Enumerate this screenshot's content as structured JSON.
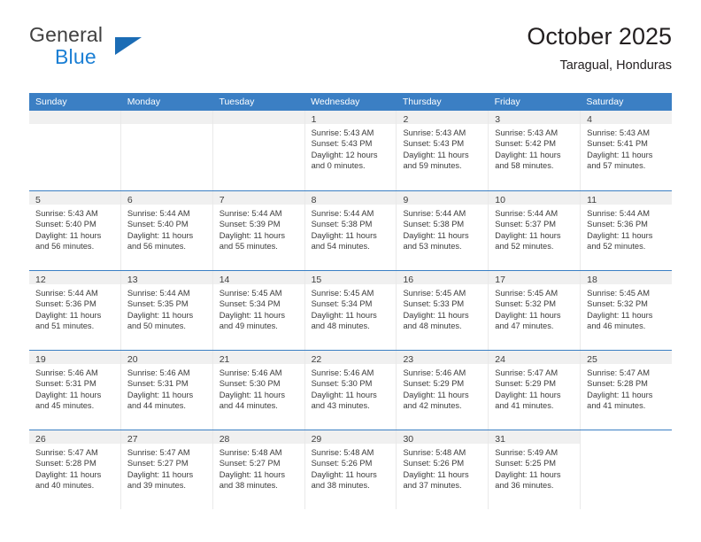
{
  "logo": {
    "word_top": "General",
    "word_bottom": "Blue",
    "triangle_color": "#1b6cb5",
    "blue_color": "#1b7fd4"
  },
  "header": {
    "title": "October 2025",
    "subtitle": "Taragual, Honduras"
  },
  "theme": {
    "header_bar": "#3b7fc4",
    "date_strip": "#f0f0f0",
    "text": "#231f20"
  },
  "weekdays": [
    "Sunday",
    "Monday",
    "Tuesday",
    "Wednesday",
    "Thursday",
    "Friday",
    "Saturday"
  ],
  "labels": {
    "sunrise_prefix": "Sunrise:",
    "sunset_prefix": "Sunset:",
    "daylight_prefix": "Daylight:"
  },
  "weeks": [
    [
      {
        "empty": true
      },
      {
        "empty": true
      },
      {
        "empty": true
      },
      {
        "day": "1",
        "sunrise": "Sunrise: 5:43 AM",
        "sunset": "Sunset: 5:43 PM",
        "daylight_1": "Daylight: 12 hours",
        "daylight_2": "and 0 minutes."
      },
      {
        "day": "2",
        "sunrise": "Sunrise: 5:43 AM",
        "sunset": "Sunset: 5:43 PM",
        "daylight_1": "Daylight: 11 hours",
        "daylight_2": "and 59 minutes."
      },
      {
        "day": "3",
        "sunrise": "Sunrise: 5:43 AM",
        "sunset": "Sunset: 5:42 PM",
        "daylight_1": "Daylight: 11 hours",
        "daylight_2": "and 58 minutes."
      },
      {
        "day": "4",
        "sunrise": "Sunrise: 5:43 AM",
        "sunset": "Sunset: 5:41 PM",
        "daylight_1": "Daylight: 11 hours",
        "daylight_2": "and 57 minutes."
      }
    ],
    [
      {
        "day": "5",
        "sunrise": "Sunrise: 5:43 AM",
        "sunset": "Sunset: 5:40 PM",
        "daylight_1": "Daylight: 11 hours",
        "daylight_2": "and 56 minutes."
      },
      {
        "day": "6",
        "sunrise": "Sunrise: 5:44 AM",
        "sunset": "Sunset: 5:40 PM",
        "daylight_1": "Daylight: 11 hours",
        "daylight_2": "and 56 minutes."
      },
      {
        "day": "7",
        "sunrise": "Sunrise: 5:44 AM",
        "sunset": "Sunset: 5:39 PM",
        "daylight_1": "Daylight: 11 hours",
        "daylight_2": "and 55 minutes."
      },
      {
        "day": "8",
        "sunrise": "Sunrise: 5:44 AM",
        "sunset": "Sunset: 5:38 PM",
        "daylight_1": "Daylight: 11 hours",
        "daylight_2": "and 54 minutes."
      },
      {
        "day": "9",
        "sunrise": "Sunrise: 5:44 AM",
        "sunset": "Sunset: 5:38 PM",
        "daylight_1": "Daylight: 11 hours",
        "daylight_2": "and 53 minutes."
      },
      {
        "day": "10",
        "sunrise": "Sunrise: 5:44 AM",
        "sunset": "Sunset: 5:37 PM",
        "daylight_1": "Daylight: 11 hours",
        "daylight_2": "and 52 minutes."
      },
      {
        "day": "11",
        "sunrise": "Sunrise: 5:44 AM",
        "sunset": "Sunset: 5:36 PM",
        "daylight_1": "Daylight: 11 hours",
        "daylight_2": "and 52 minutes."
      }
    ],
    [
      {
        "day": "12",
        "sunrise": "Sunrise: 5:44 AM",
        "sunset": "Sunset: 5:36 PM",
        "daylight_1": "Daylight: 11 hours",
        "daylight_2": "and 51 minutes."
      },
      {
        "day": "13",
        "sunrise": "Sunrise: 5:44 AM",
        "sunset": "Sunset: 5:35 PM",
        "daylight_1": "Daylight: 11 hours",
        "daylight_2": "and 50 minutes."
      },
      {
        "day": "14",
        "sunrise": "Sunrise: 5:45 AM",
        "sunset": "Sunset: 5:34 PM",
        "daylight_1": "Daylight: 11 hours",
        "daylight_2": "and 49 minutes."
      },
      {
        "day": "15",
        "sunrise": "Sunrise: 5:45 AM",
        "sunset": "Sunset: 5:34 PM",
        "daylight_1": "Daylight: 11 hours",
        "daylight_2": "and 48 minutes."
      },
      {
        "day": "16",
        "sunrise": "Sunrise: 5:45 AM",
        "sunset": "Sunset: 5:33 PM",
        "daylight_1": "Daylight: 11 hours",
        "daylight_2": "and 48 minutes."
      },
      {
        "day": "17",
        "sunrise": "Sunrise: 5:45 AM",
        "sunset": "Sunset: 5:32 PM",
        "daylight_1": "Daylight: 11 hours",
        "daylight_2": "and 47 minutes."
      },
      {
        "day": "18",
        "sunrise": "Sunrise: 5:45 AM",
        "sunset": "Sunset: 5:32 PM",
        "daylight_1": "Daylight: 11 hours",
        "daylight_2": "and 46 minutes."
      }
    ],
    [
      {
        "day": "19",
        "sunrise": "Sunrise: 5:46 AM",
        "sunset": "Sunset: 5:31 PM",
        "daylight_1": "Daylight: 11 hours",
        "daylight_2": "and 45 minutes."
      },
      {
        "day": "20",
        "sunrise": "Sunrise: 5:46 AM",
        "sunset": "Sunset: 5:31 PM",
        "daylight_1": "Daylight: 11 hours",
        "daylight_2": "and 44 minutes."
      },
      {
        "day": "21",
        "sunrise": "Sunrise: 5:46 AM",
        "sunset": "Sunset: 5:30 PM",
        "daylight_1": "Daylight: 11 hours",
        "daylight_2": "and 44 minutes."
      },
      {
        "day": "22",
        "sunrise": "Sunrise: 5:46 AM",
        "sunset": "Sunset: 5:30 PM",
        "daylight_1": "Daylight: 11 hours",
        "daylight_2": "and 43 minutes."
      },
      {
        "day": "23",
        "sunrise": "Sunrise: 5:46 AM",
        "sunset": "Sunset: 5:29 PM",
        "daylight_1": "Daylight: 11 hours",
        "daylight_2": "and 42 minutes."
      },
      {
        "day": "24",
        "sunrise": "Sunrise: 5:47 AM",
        "sunset": "Sunset: 5:29 PM",
        "daylight_1": "Daylight: 11 hours",
        "daylight_2": "and 41 minutes."
      },
      {
        "day": "25",
        "sunrise": "Sunrise: 5:47 AM",
        "sunset": "Sunset: 5:28 PM",
        "daylight_1": "Daylight: 11 hours",
        "daylight_2": "and 41 minutes."
      }
    ],
    [
      {
        "day": "26",
        "sunrise": "Sunrise: 5:47 AM",
        "sunset": "Sunset: 5:28 PM",
        "daylight_1": "Daylight: 11 hours",
        "daylight_2": "and 40 minutes."
      },
      {
        "day": "27",
        "sunrise": "Sunrise: 5:47 AM",
        "sunset": "Sunset: 5:27 PM",
        "daylight_1": "Daylight: 11 hours",
        "daylight_2": "and 39 minutes."
      },
      {
        "day": "28",
        "sunrise": "Sunrise: 5:48 AM",
        "sunset": "Sunset: 5:27 PM",
        "daylight_1": "Daylight: 11 hours",
        "daylight_2": "and 38 minutes."
      },
      {
        "day": "29",
        "sunrise": "Sunrise: 5:48 AM",
        "sunset": "Sunset: 5:26 PM",
        "daylight_1": "Daylight: 11 hours",
        "daylight_2": "and 38 minutes."
      },
      {
        "day": "30",
        "sunrise": "Sunrise: 5:48 AM",
        "sunset": "Sunset: 5:26 PM",
        "daylight_1": "Daylight: 11 hours",
        "daylight_2": "and 37 minutes."
      },
      {
        "day": "31",
        "sunrise": "Sunrise: 5:49 AM",
        "sunset": "Sunset: 5:25 PM",
        "daylight_1": "Daylight: 11 hours",
        "daylight_2": "and 36 minutes."
      },
      {
        "empty": true,
        "no_strip": true
      }
    ]
  ]
}
